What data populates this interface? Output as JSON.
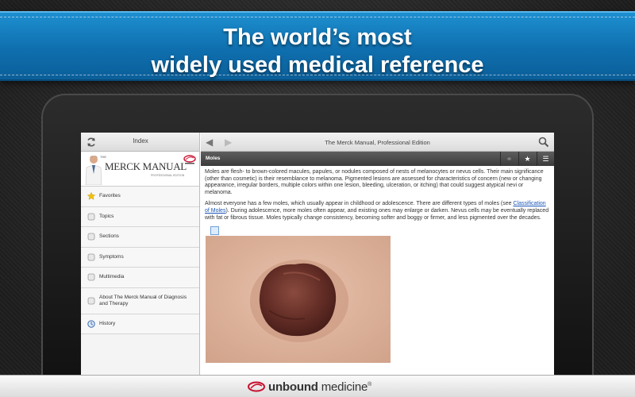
{
  "banner": {
    "line1": "The world’s most",
    "line2": "widely used medical reference"
  },
  "sidebar": {
    "title": "Index",
    "sync_icon": "sync-icon",
    "logo": {
      "prefix": "THE",
      "title": "MERCK MANUAL",
      "subtitle": "PROFESSIONAL EDITION"
    },
    "items": [
      {
        "label": "Favorites",
        "icon": "star-icon"
      },
      {
        "label": "Topics",
        "icon": "topics-icon"
      },
      {
        "label": "Sections",
        "icon": "sections-icon"
      },
      {
        "label": "Symptoms",
        "icon": "symptoms-icon"
      },
      {
        "label": "Multimedia",
        "icon": "multimedia-icon"
      },
      {
        "label": "About The Merck Manual of Diagnosis and Therapy",
        "icon": "about-icon"
      },
      {
        "label": "History",
        "icon": "history-icon"
      }
    ]
  },
  "content_header": {
    "title": "The Merck Manual, Professional Edition",
    "back_icon": "back-arrow-icon",
    "forward_icon": "forward-arrow-icon",
    "search_icon": "search-icon"
  },
  "section": {
    "title": "Moles",
    "tools": [
      "link-icon",
      "star-icon",
      "sort-icon"
    ]
  },
  "article": {
    "para1": "Moles are flesh- to brown-colored macules, papules, or nodules composed of nests of melanocytes or nevus cells. Their main significance (other than cosmetic) is their resemblance to melanoma. Pigmented lesions are assessed for characteristics of concern (new or changing appearance, irregular borders, multiple colors within one lesion, bleeding, ulceration, or itching) that could suggest atypical nevi or melanoma.",
    "para2_before": "Almost everyone has a few moles, which usually appear in childhood or adolescence. There are different types of moles (see ",
    "para2_link": "Classification of Moles",
    "para2_after": "). During adolescence, more moles often appear, and existing ones may enlarge or darken. Nevus cells may be eventually replaced with fat or fibrous tissue. Moles typically change consistency, becoming softer and boggy or firmer, and less pigmented over the decades."
  },
  "footer": {
    "brand_bold": "unbound",
    "brand_rest": " medicine",
    "trademark": "®"
  },
  "colors": {
    "banner_blue": "#1d8fd0",
    "link_blue": "#1a56b8",
    "favorite_star": "#f2c10a"
  }
}
